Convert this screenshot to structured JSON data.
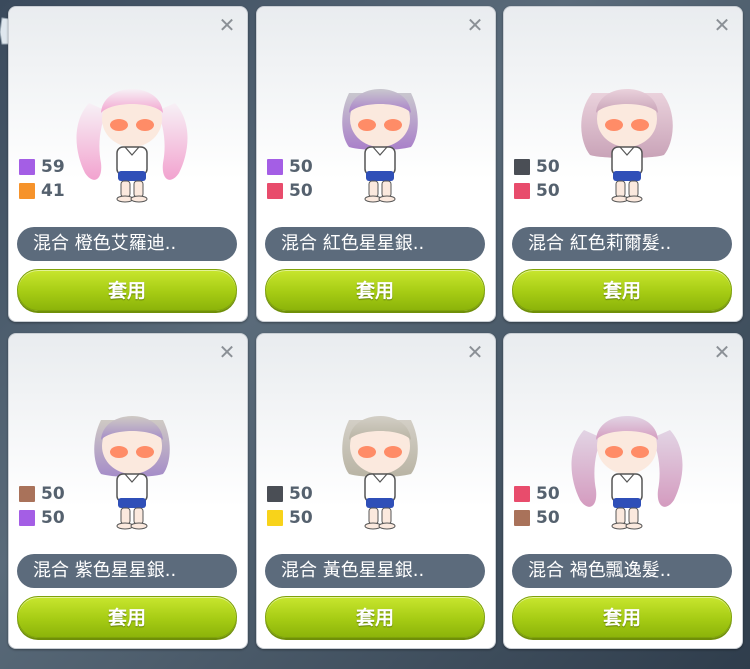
{
  "cards": [
    {
      "name": "混合  橙色艾羅迪..",
      "apply_label": "套用",
      "stats": [
        {
          "color": "#a45ee5",
          "value": "59"
        },
        {
          "color": "#f6932b",
          "value": "41"
        }
      ],
      "hair": {
        "top": "#f7f1f6",
        "bottom": "#f2a3cf",
        "style": "twin"
      }
    },
    {
      "name": "混合  紅色星星銀..",
      "apply_label": "套用",
      "stats": [
        {
          "color": "#a45ee5",
          "value": "50"
        },
        {
          "color": "#e84c6c",
          "value": "50"
        }
      ],
      "hair": {
        "top": "#c9c7ce",
        "bottom": "#a97fc9",
        "style": "bob"
      }
    },
    {
      "name": "混合  紅色莉爾髮..",
      "apply_label": "套用",
      "stats": [
        {
          "color": "#4a4e55",
          "value": "50"
        },
        {
          "color": "#e84c6c",
          "value": "50"
        }
      ],
      "hair": {
        "top": "#ead2dc",
        "bottom": "#c9a3b8",
        "style": "wavy"
      }
    },
    {
      "name": "混合  紫色星星銀..",
      "apply_label": "套用",
      "stats": [
        {
          "color": "#a9725a",
          "value": "50"
        },
        {
          "color": "#a45ee5",
          "value": "50"
        }
      ],
      "hair": {
        "top": "#cfcac4",
        "bottom": "#a58cc8",
        "style": "bob"
      }
    },
    {
      "name": "混合  黃色星星銀..",
      "apply_label": "套用",
      "stats": [
        {
          "color": "#4a4e55",
          "value": "50"
        },
        {
          "color": "#f8d31a",
          "value": "50"
        }
      ],
      "hair": {
        "top": "#d3cfc6",
        "bottom": "#b9b4a4",
        "style": "bob"
      }
    },
    {
      "name": "混合  褐色飄逸髮..",
      "apply_label": "套用",
      "stats": [
        {
          "color": "#e84c6c",
          "value": "50"
        },
        {
          "color": "#a9725a",
          "value": "50"
        }
      ],
      "hair": {
        "top": "#e2d4e4",
        "bottom": "#d49bbf",
        "style": "twin"
      }
    }
  ],
  "icons": {
    "close": "close-icon",
    "hair_preview": "character-avatar"
  }
}
